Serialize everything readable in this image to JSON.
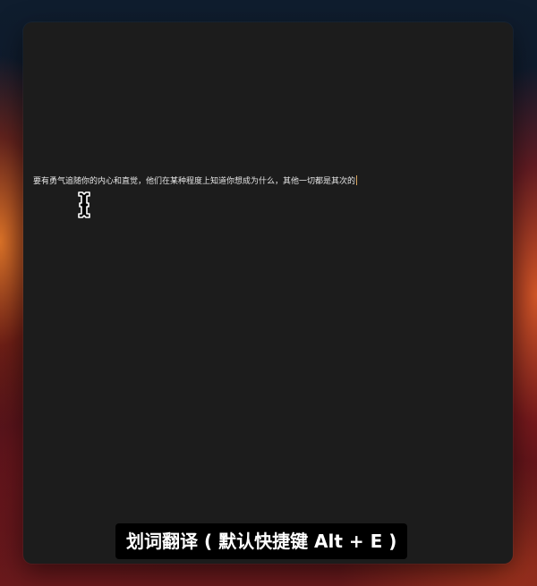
{
  "editor": {
    "text": "要有勇气追随你的内心和直觉，他们在某种程度上知道你想成为什么，其他一切都是其次的"
  },
  "caption": {
    "text": "划词翻译 ( 默认快捷键 Alt + E )"
  },
  "icons": {
    "cursor": "text-cursor-ibeam-icon"
  },
  "colors": {
    "window_bg": "#1c1c1c",
    "text": "#e6e6e6",
    "caret": "#d9a560",
    "caption_bg": "#000000",
    "caption_text": "#ffffff"
  }
}
